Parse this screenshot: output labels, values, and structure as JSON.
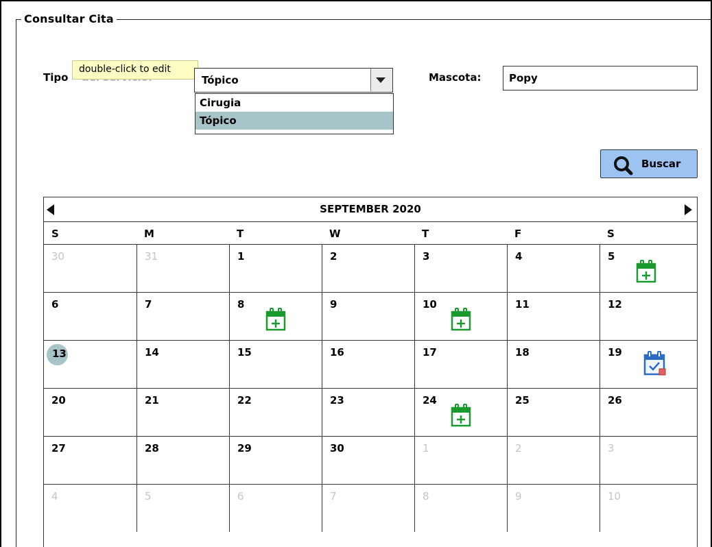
{
  "form": {
    "legend": "Consultar Cita",
    "tipo_label": "Tipo",
    "tipo_ghost": "del servicio:",
    "tooltip": "double-click to edit",
    "tipo_selected": "Tópico",
    "tipo_options": [
      {
        "label": "Cirugia",
        "selected": false
      },
      {
        "label": "Tópico",
        "selected": true
      }
    ],
    "mascota_label": "Mascota:",
    "mascota_value": "Popy",
    "buscar_label": "Buscar",
    "icons": {
      "search": "search-icon",
      "dropdown": "chevron-down-icon"
    }
  },
  "calendar": {
    "month_label": "SEPTEMBER 2020",
    "weekdays": [
      "S",
      "M",
      "T",
      "W",
      "T",
      "F",
      "S"
    ],
    "weeks": [
      [
        {
          "d": "30",
          "out": true
        },
        {
          "d": "31",
          "out": true
        },
        {
          "d": "1"
        },
        {
          "d": "2"
        },
        {
          "d": "3"
        },
        {
          "d": "4"
        },
        {
          "d": "5",
          "icon": "calendar-add"
        }
      ],
      [
        {
          "d": "6"
        },
        {
          "d": "7"
        },
        {
          "d": "8",
          "icon": "calendar-add"
        },
        {
          "d": "9"
        },
        {
          "d": "10",
          "icon": "calendar-add"
        },
        {
          "d": "11"
        },
        {
          "d": "12"
        }
      ],
      [
        {
          "d": "13",
          "today": true
        },
        {
          "d": "14"
        },
        {
          "d": "15"
        },
        {
          "d": "16"
        },
        {
          "d": "17"
        },
        {
          "d": "18"
        },
        {
          "d": "19",
          "icon": "calendar-booked"
        }
      ],
      [
        {
          "d": "20"
        },
        {
          "d": "21"
        },
        {
          "d": "22"
        },
        {
          "d": "23"
        },
        {
          "d": "24",
          "icon": "calendar-add"
        },
        {
          "d": "25"
        },
        {
          "d": "26"
        }
      ],
      [
        {
          "d": "27"
        },
        {
          "d": "28"
        },
        {
          "d": "29"
        },
        {
          "d": "30"
        },
        {
          "d": "1",
          "out": true
        },
        {
          "d": "2",
          "out": true
        },
        {
          "d": "3",
          "out": true
        }
      ],
      [
        {
          "d": "4",
          "out": true
        },
        {
          "d": "5",
          "out": true
        },
        {
          "d": "6",
          "out": true
        },
        {
          "d": "7",
          "out": true
        },
        {
          "d": "8",
          "out": true
        },
        {
          "d": "9",
          "out": true
        },
        {
          "d": "10",
          "out": true
        }
      ]
    ],
    "colors": {
      "add_icon": "#1a9a2e",
      "booked_icon": "#2d6bc4",
      "today": "#a7c4c8"
    }
  }
}
